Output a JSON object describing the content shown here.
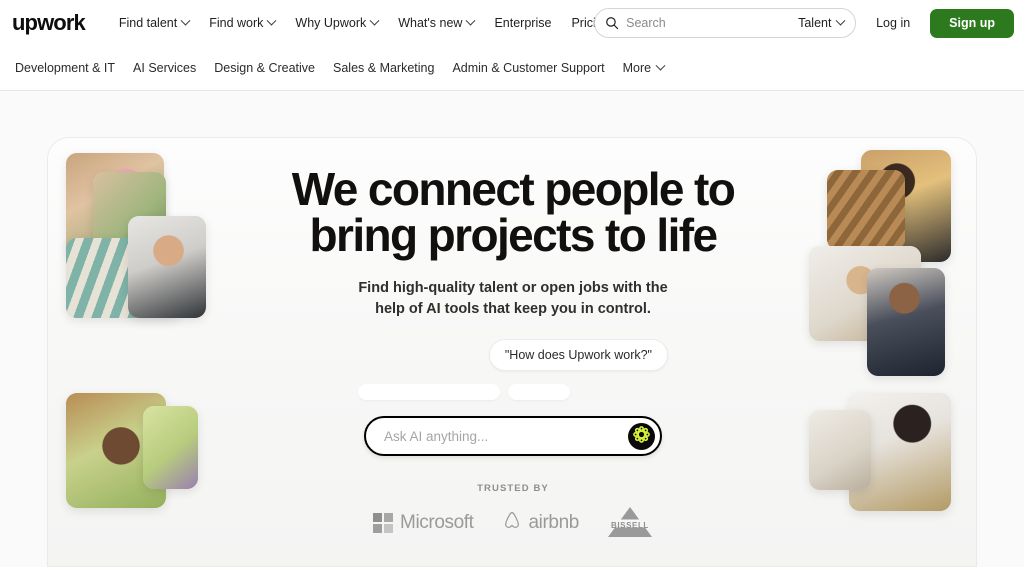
{
  "brand": {
    "logo_text": "upwork"
  },
  "nav_primary": {
    "links": [
      {
        "label": "Find talent",
        "has_caret": true
      },
      {
        "label": "Find work",
        "has_caret": true
      },
      {
        "label": "Why Upwork",
        "has_caret": true
      },
      {
        "label": "What's new",
        "has_caret": true
      },
      {
        "label": "Enterprise",
        "has_caret": false
      },
      {
        "label": "Pricing",
        "has_caret": false
      }
    ],
    "search": {
      "placeholder": "Search",
      "value": "",
      "scope": "Talent",
      "icon": "search-icon"
    },
    "login_label": "Log in",
    "signup_label": "Sign up",
    "signup_color": "#2d7a1e"
  },
  "nav_secondary": {
    "categories": [
      {
        "label": "Development & IT",
        "has_caret": false
      },
      {
        "label": "AI Services",
        "has_caret": false
      },
      {
        "label": "Design & Creative",
        "has_caret": false
      },
      {
        "label": "Sales & Marketing",
        "has_caret": false
      },
      {
        "label": "Admin & Customer Support",
        "has_caret": false
      },
      {
        "label": "More",
        "has_caret": true
      }
    ]
  },
  "hero": {
    "headline_line1": "We connect people to",
    "headline_line2": "bring projects to life",
    "subhead_line1": "Find high-quality talent or open jobs with the",
    "subhead_line2": "help of AI tools that keep you in control.",
    "chat_bubble": "\"How does Upwork work?\"",
    "ask_placeholder": "Ask AI anything...",
    "ask_value": "",
    "ask_button_icon": "ai-sparkle-icon",
    "ask_button_accent": "#d7ef3c",
    "trusted_label": "TRUSTED BY",
    "trusted_logos": [
      {
        "name": "Microsoft",
        "text": "Microsoft"
      },
      {
        "name": "airbnb",
        "text": "airbnb"
      },
      {
        "name": "BISSELL",
        "text": "BISSELL"
      }
    ]
  },
  "collage_left": {
    "alt": "photo-collage-left",
    "tiles": [
      {
        "id": "lt1",
        "alt": "person-pink-hair"
      },
      {
        "id": "lt2",
        "alt": "plant-backdrop"
      },
      {
        "id": "lt3",
        "alt": "striped-sweater"
      },
      {
        "id": "lt4",
        "alt": "bearded-man-glasses"
      },
      {
        "id": "lt5",
        "alt": "woman-florist-phone"
      },
      {
        "id": "lt6",
        "alt": "flowers-backdrop"
      }
    ]
  },
  "collage_right": {
    "alt": "photo-collage-right",
    "tiles": [
      {
        "id": "rt1",
        "alt": "woman-holding-tablet"
      },
      {
        "id": "rt2",
        "alt": "wooden-ceiling"
      },
      {
        "id": "rt3",
        "alt": "woman-glasses-office"
      },
      {
        "id": "rt4",
        "alt": "man-suit-beard"
      },
      {
        "id": "rt5",
        "alt": "woman-at-laptop"
      },
      {
        "id": "rt6",
        "alt": "office-desk"
      }
    ]
  }
}
